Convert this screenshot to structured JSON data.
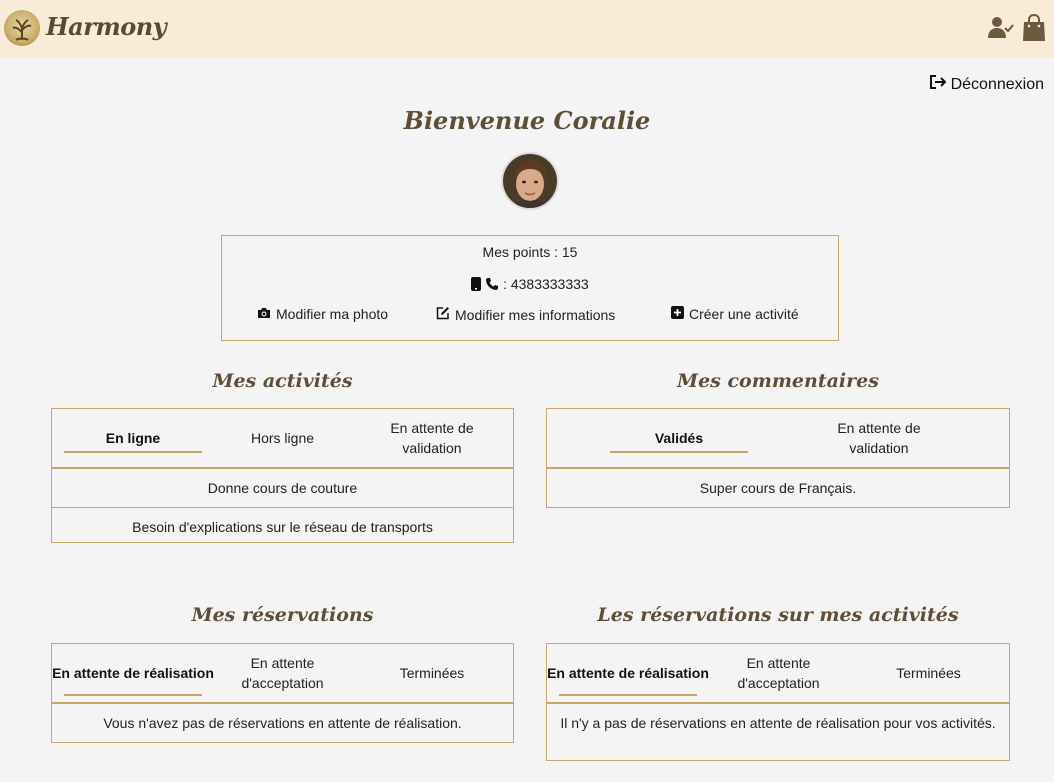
{
  "header": {
    "brand": "Harmony",
    "icons": [
      "harmony-logo-icon",
      "user-check-icon",
      "shopping-bag-icon"
    ]
  },
  "logout": {
    "label": "Déconnexion",
    "icon": "sign-out-icon"
  },
  "welcome": "Bienvenue Coralie",
  "profile": {
    "points_label": "Mes points : 15",
    "phone": ": 4383333333",
    "actions": {
      "photo": "Modifier ma photo",
      "info": "Modifier mes informations",
      "create": "Créer une activité"
    }
  },
  "activities": {
    "title": "Mes activités",
    "tabs": [
      "En ligne",
      "Hors ligne",
      "En attente de validation"
    ],
    "items": [
      "Donne cours de couture",
      "Besoin d'explications sur le réseau de transports"
    ]
  },
  "comments": {
    "title": "Mes commentaires",
    "tabs": [
      "Validés",
      "En attente de validation"
    ],
    "items": [
      "Super cours de Français."
    ]
  },
  "reservations": {
    "title": "Mes réservations",
    "tabs": [
      "En attente de réalisation",
      "En attente d'acceptation",
      "Terminées"
    ],
    "message": "Vous n'avez pas de réservations en attente de réalisation."
  },
  "activity_reservations": {
    "title": "Les réservations sur mes activités",
    "tabs": [
      "En attente de réalisation",
      "En attente d'acceptation",
      "Terminées"
    ],
    "message": "Il n'y a pas de réservations en attente de réalisation pour vos activités."
  },
  "colors": {
    "header_bg": "#f8ecd9",
    "accent_border": "#c5a76b",
    "title_brown": "#5e4e38",
    "page_bg": "#f4f4f4"
  }
}
